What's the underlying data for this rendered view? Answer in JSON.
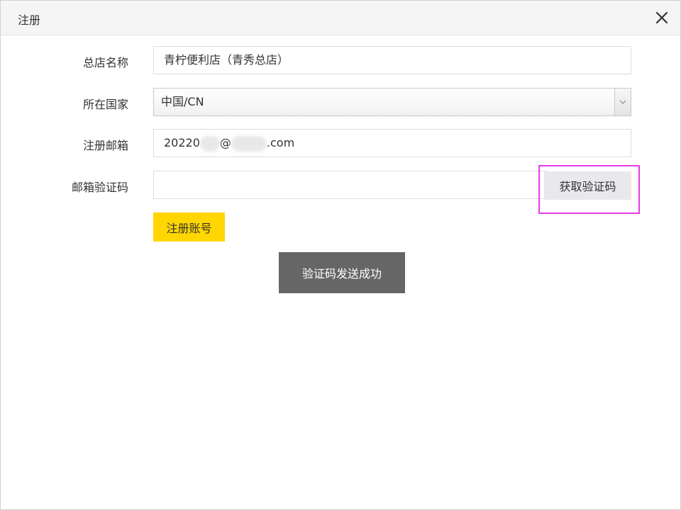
{
  "dialog": {
    "title": "注册",
    "close_icon": "close-icon"
  },
  "form": {
    "store_name": {
      "label": "总店名称",
      "value": "青柠便利店（青秀总店）"
    },
    "country": {
      "label": "所在国家",
      "selected": "中国/CN"
    },
    "email": {
      "label": "注册邮箱",
      "prefix": "20220",
      "at": "@",
      "suffix": ".com"
    },
    "verify_code": {
      "label": "邮箱验证码",
      "value": "",
      "button_label": "获取验证码"
    },
    "register_button_label": "注册账号"
  },
  "toast": {
    "message": "验证码发送成功"
  },
  "colors": {
    "register_button": "#ffd600",
    "toast_background": "#666666",
    "highlight_border": "#e83be8",
    "code_button": "#e9e9ed"
  }
}
